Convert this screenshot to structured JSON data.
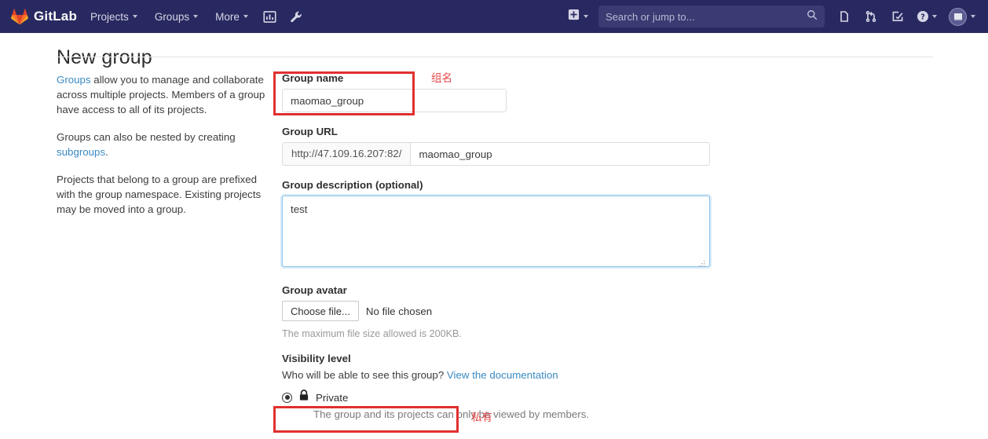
{
  "navbar": {
    "brand": "GitLab",
    "brand_logo_icon": "gitlab-fox-logo",
    "items": [
      {
        "label": "Projects",
        "icon": "chevron-down-icon"
      },
      {
        "label": "Groups",
        "icon": "chevron-down-icon"
      },
      {
        "label": "More",
        "icon": "chevron-down-icon"
      }
    ],
    "icon_buttons": [
      {
        "name": "analytics-icon"
      },
      {
        "name": "wrench-icon"
      }
    ],
    "create_new": {
      "icon": "plus-square-icon",
      "caret": "chevron-down-icon"
    },
    "search": {
      "placeholder": "Search or jump to...",
      "value": "",
      "icon": "search-icon"
    },
    "right_icons": [
      {
        "name": "issues-icon"
      },
      {
        "name": "merge-request-icon"
      },
      {
        "name": "todos-icon"
      },
      {
        "name": "help-icon"
      }
    ],
    "user": {
      "icon": "avatar",
      "caret": "chevron-down-icon"
    },
    "bg_color": "#292961"
  },
  "page": {
    "title": "New group"
  },
  "sidebar": {
    "para1_link": "Groups",
    "para1_rest": " allow you to manage and collaborate across multiple projects. Members of a group have access to all of its projects.",
    "para2_prefix": "Groups can also be nested by creating ",
    "para2_link": "subgroups",
    "para2_suffix": ".",
    "para3": "Projects that belong to a group are prefixed with the group namespace. Existing projects may be moved into a group."
  },
  "form": {
    "group_name": {
      "label": "Group name",
      "value": "maomao_group",
      "placeholder": ""
    },
    "group_url": {
      "label": "Group URL",
      "prefix": "http://47.109.16.207:82/",
      "value": "maomao_group",
      "placeholder": ""
    },
    "group_description": {
      "label": "Group description (optional)",
      "value": "test",
      "placeholder": ""
    },
    "group_avatar": {
      "label": "Group avatar",
      "button": "Choose file...",
      "file_status": "No file chosen",
      "hint": "The maximum file size allowed is 200KB."
    },
    "visibility": {
      "label": "Visibility level",
      "question": "Who will be able to see this group? ",
      "doc_link": "View the documentation",
      "option_label": "Private",
      "option_icon": "lock-icon",
      "option_desc": "The group and its projects can only be viewed by members.",
      "selected": true
    }
  },
  "annotations": {
    "color": "#e03030",
    "text_color": "#e84a4a",
    "group_name_note": "组名",
    "private_note": "私有"
  }
}
